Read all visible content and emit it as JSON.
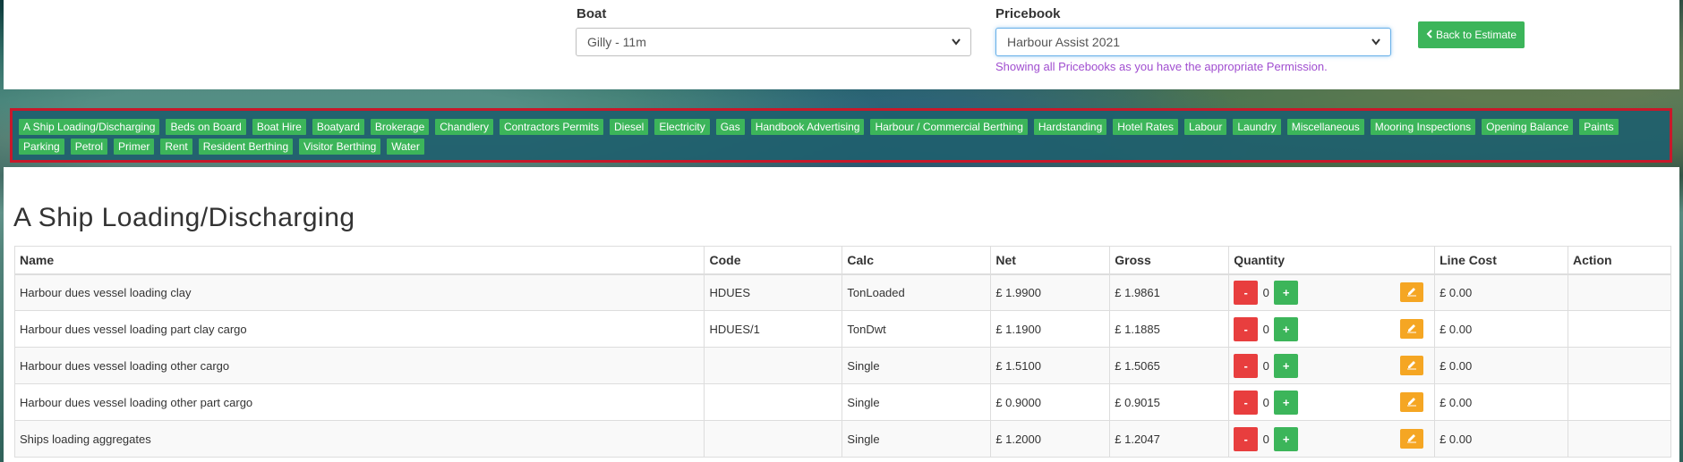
{
  "header": {
    "boat_label": "Boat",
    "boat_value": "Gilly - 11m",
    "pricebook_label": "Pricebook",
    "pricebook_value": "Harbour Assist 2021",
    "pricebook_help": "Showing all Pricebooks as you have the appropriate Permission.",
    "back_button": "Back to Estimate"
  },
  "categories": [
    "A Ship Loading/Discharging",
    "Beds on Board",
    "Boat Hire",
    "Boatyard",
    "Brokerage",
    "Chandlery",
    "Contractors Permits",
    "Diesel",
    "Electricity",
    "Gas",
    "Handbook Advertising",
    "Harbour / Commercial Berthing",
    "Hardstanding",
    "Hotel Rates",
    "Labour",
    "Laundry",
    "Miscellaneous",
    "Mooring Inspections",
    "Opening Balance",
    "Paints",
    "Parking",
    "Petrol",
    "Primer",
    "Rent",
    "Resident Berthing",
    "Visitor Berthing",
    "Water"
  ],
  "section_title": "A Ship Loading/Discharging",
  "table": {
    "headers": [
      "Name",
      "Code",
      "Calc",
      "Net",
      "Gross",
      "Quantity",
      "Line Cost",
      "Action"
    ],
    "rows": [
      {
        "name": "Harbour dues vessel loading clay",
        "code": "HDUES",
        "calc": "TonLoaded",
        "net": "£ 1.9900",
        "gross": "£ 1.9861",
        "qty": "0",
        "line_cost": "£ 0.00"
      },
      {
        "name": "Harbour dues vessel loading part clay cargo",
        "code": "HDUES/1",
        "calc": "TonDwt",
        "net": "£ 1.1900",
        "gross": "£ 1.1885",
        "qty": "0",
        "line_cost": "£ 0.00"
      },
      {
        "name": "Harbour dues vessel loading other cargo",
        "code": "",
        "calc": "Single",
        "net": "£ 1.5100",
        "gross": "£ 1.5065",
        "qty": "0",
        "line_cost": "£ 0.00"
      },
      {
        "name": "Harbour dues vessel loading other part cargo",
        "code": "",
        "calc": "Single",
        "net": "£ 0.9000",
        "gross": "£ 0.9015",
        "qty": "0",
        "line_cost": "£ 0.00"
      },
      {
        "name": "Ships loading aggregates",
        "code": "",
        "calc": "Single",
        "net": "£ 1.2000",
        "gross": "£ 1.2047",
        "qty": "0",
        "line_cost": "£ 0.00"
      }
    ]
  },
  "controls": {
    "minus": "-",
    "plus": "+"
  },
  "colors": {
    "primary_green": "#3cb55a",
    "danger_red": "#e83e3e",
    "warning_orange": "#f5a623",
    "highlight_border": "#c8182a"
  }
}
